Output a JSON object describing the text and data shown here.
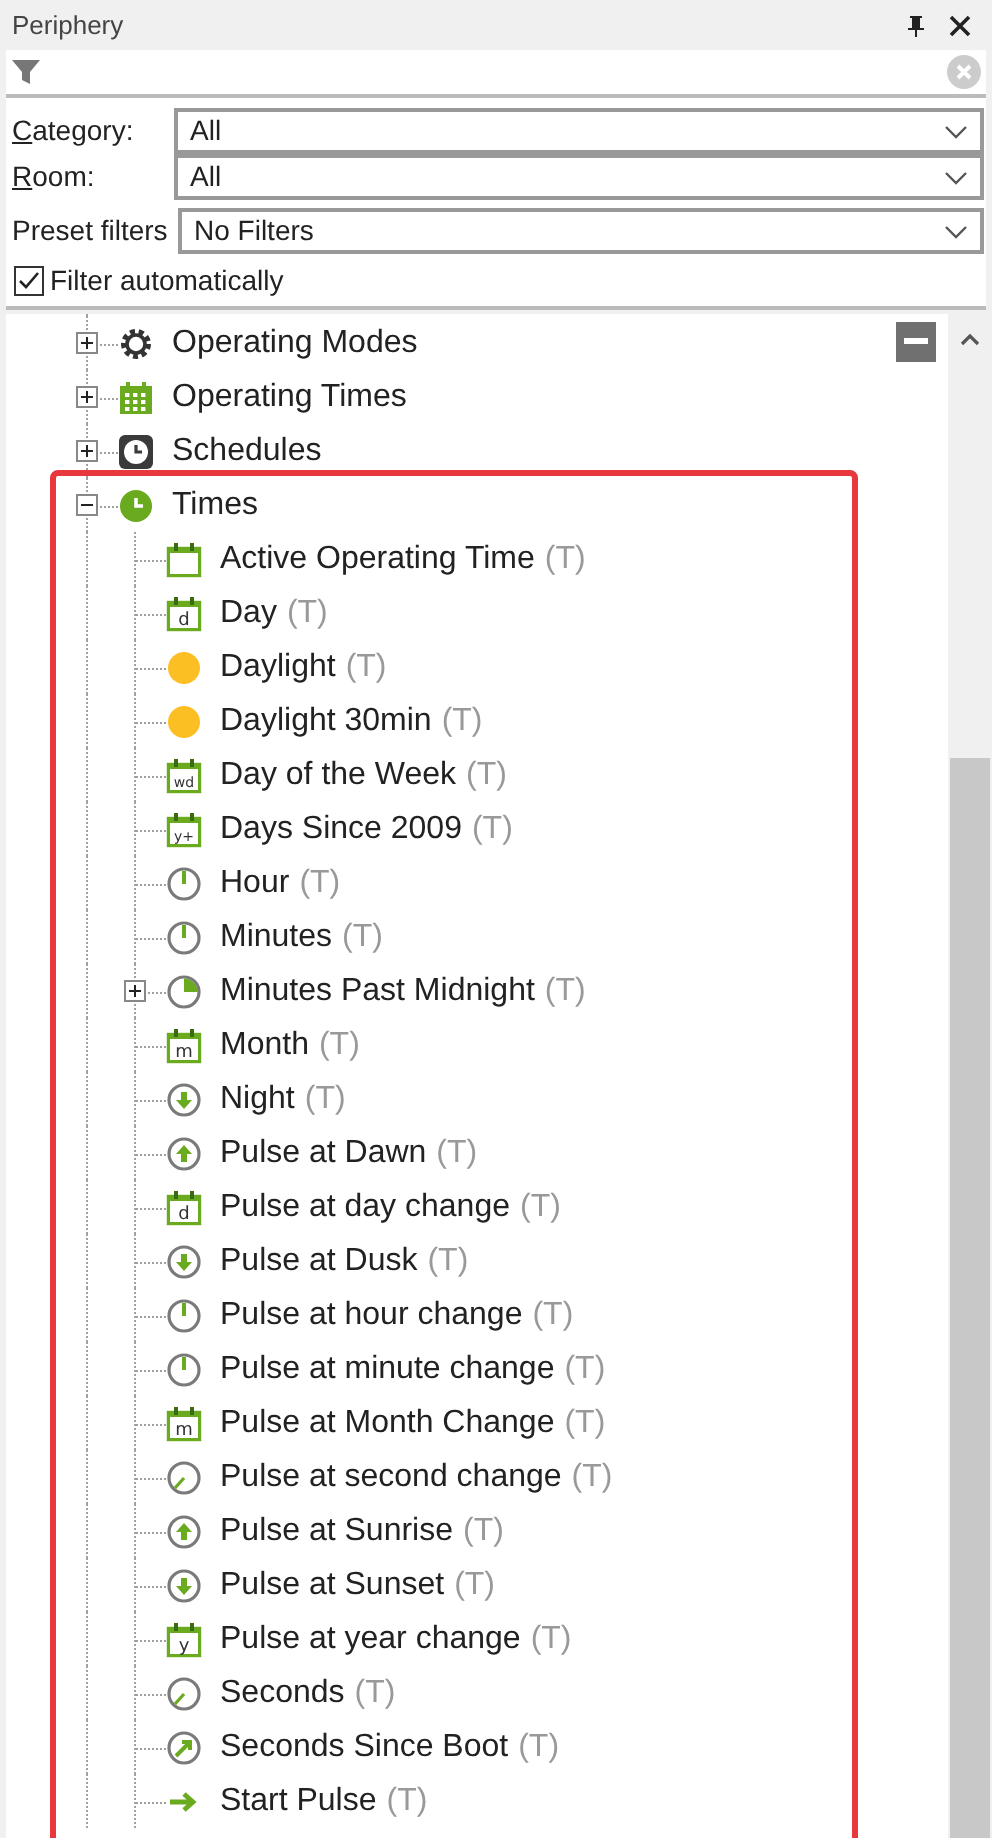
{
  "panel": {
    "title": "Periphery"
  },
  "filters": [
    {
      "label": "Category:",
      "underline_first": true,
      "value": "All"
    },
    {
      "label": "Room:",
      "underline_first": true,
      "value": "All"
    },
    {
      "label": "Preset filters",
      "underline_first": false,
      "value": "No Filters"
    }
  ],
  "auto_filter": {
    "label": "Filter automatically",
    "checked": true
  },
  "tree": [
    {
      "label": "Operating Modes",
      "kind": "gear",
      "expanded": false
    },
    {
      "label": "Operating Times",
      "kind": "calendar-grid",
      "expanded": false
    },
    {
      "label": "Schedules",
      "kind": "clock-dark",
      "expanded": false
    },
    {
      "label": "Times",
      "kind": "clock-green",
      "expanded": true,
      "highlighted": true,
      "children": [
        {
          "label": "Active Operating Time",
          "suffix": "(T)",
          "kind": "calendar"
        },
        {
          "label": "Day",
          "suffix": "(T)",
          "kind": "calendar",
          "icon_text": "d"
        },
        {
          "label": "Daylight",
          "suffix": "(T)",
          "kind": "sun"
        },
        {
          "label": "Daylight 30min",
          "suffix": "(T)",
          "kind": "sun"
        },
        {
          "label": "Day of the Week",
          "suffix": "(T)",
          "kind": "calendar",
          "icon_text": "wd"
        },
        {
          "label": "Days Since 2009",
          "suffix": "(T)",
          "kind": "calendar",
          "icon_text": "y+"
        },
        {
          "label": "Hour",
          "suffix": "(T)",
          "kind": "clock-hand"
        },
        {
          "label": "Minutes",
          "suffix": "(T)",
          "kind": "clock-hand"
        },
        {
          "label": "Minutes Past Midnight",
          "suffix": "(T)",
          "kind": "clock-pie",
          "expanded": false
        },
        {
          "label": "Month",
          "suffix": "(T)",
          "kind": "calendar",
          "icon_text": "m"
        },
        {
          "label": "Night",
          "suffix": "(T)",
          "kind": "clock-down"
        },
        {
          "label": "Pulse at Dawn",
          "suffix": "(T)",
          "kind": "clock-up"
        },
        {
          "label": "Pulse at day change",
          "suffix": "(T)",
          "kind": "calendar",
          "icon_text": "d"
        },
        {
          "label": "Pulse at Dusk",
          "suffix": "(T)",
          "kind": "clock-down"
        },
        {
          "label": "Pulse at hour change",
          "suffix": "(T)",
          "kind": "clock-hand"
        },
        {
          "label": "Pulse at minute change",
          "suffix": "(T)",
          "kind": "clock-hand"
        },
        {
          "label": "Pulse at Month Change",
          "suffix": "(T)",
          "kind": "calendar",
          "icon_text": "m"
        },
        {
          "label": "Pulse at second change",
          "suffix": "(T)",
          "kind": "clock-second"
        },
        {
          "label": "Pulse at Sunrise",
          "suffix": "(T)",
          "kind": "clock-up"
        },
        {
          "label": "Pulse at Sunset",
          "suffix": "(T)",
          "kind": "clock-down"
        },
        {
          "label": "Pulse at year change",
          "suffix": "(T)",
          "kind": "calendar",
          "icon_text": "y"
        },
        {
          "label": "Seconds",
          "suffix": "(T)",
          "kind": "clock-second"
        },
        {
          "label": "Seconds Since Boot",
          "suffix": "(T)",
          "kind": "clock-boot"
        },
        {
          "label": "Start Pulse",
          "suffix": "(T)",
          "kind": "arrow"
        }
      ]
    }
  ]
}
